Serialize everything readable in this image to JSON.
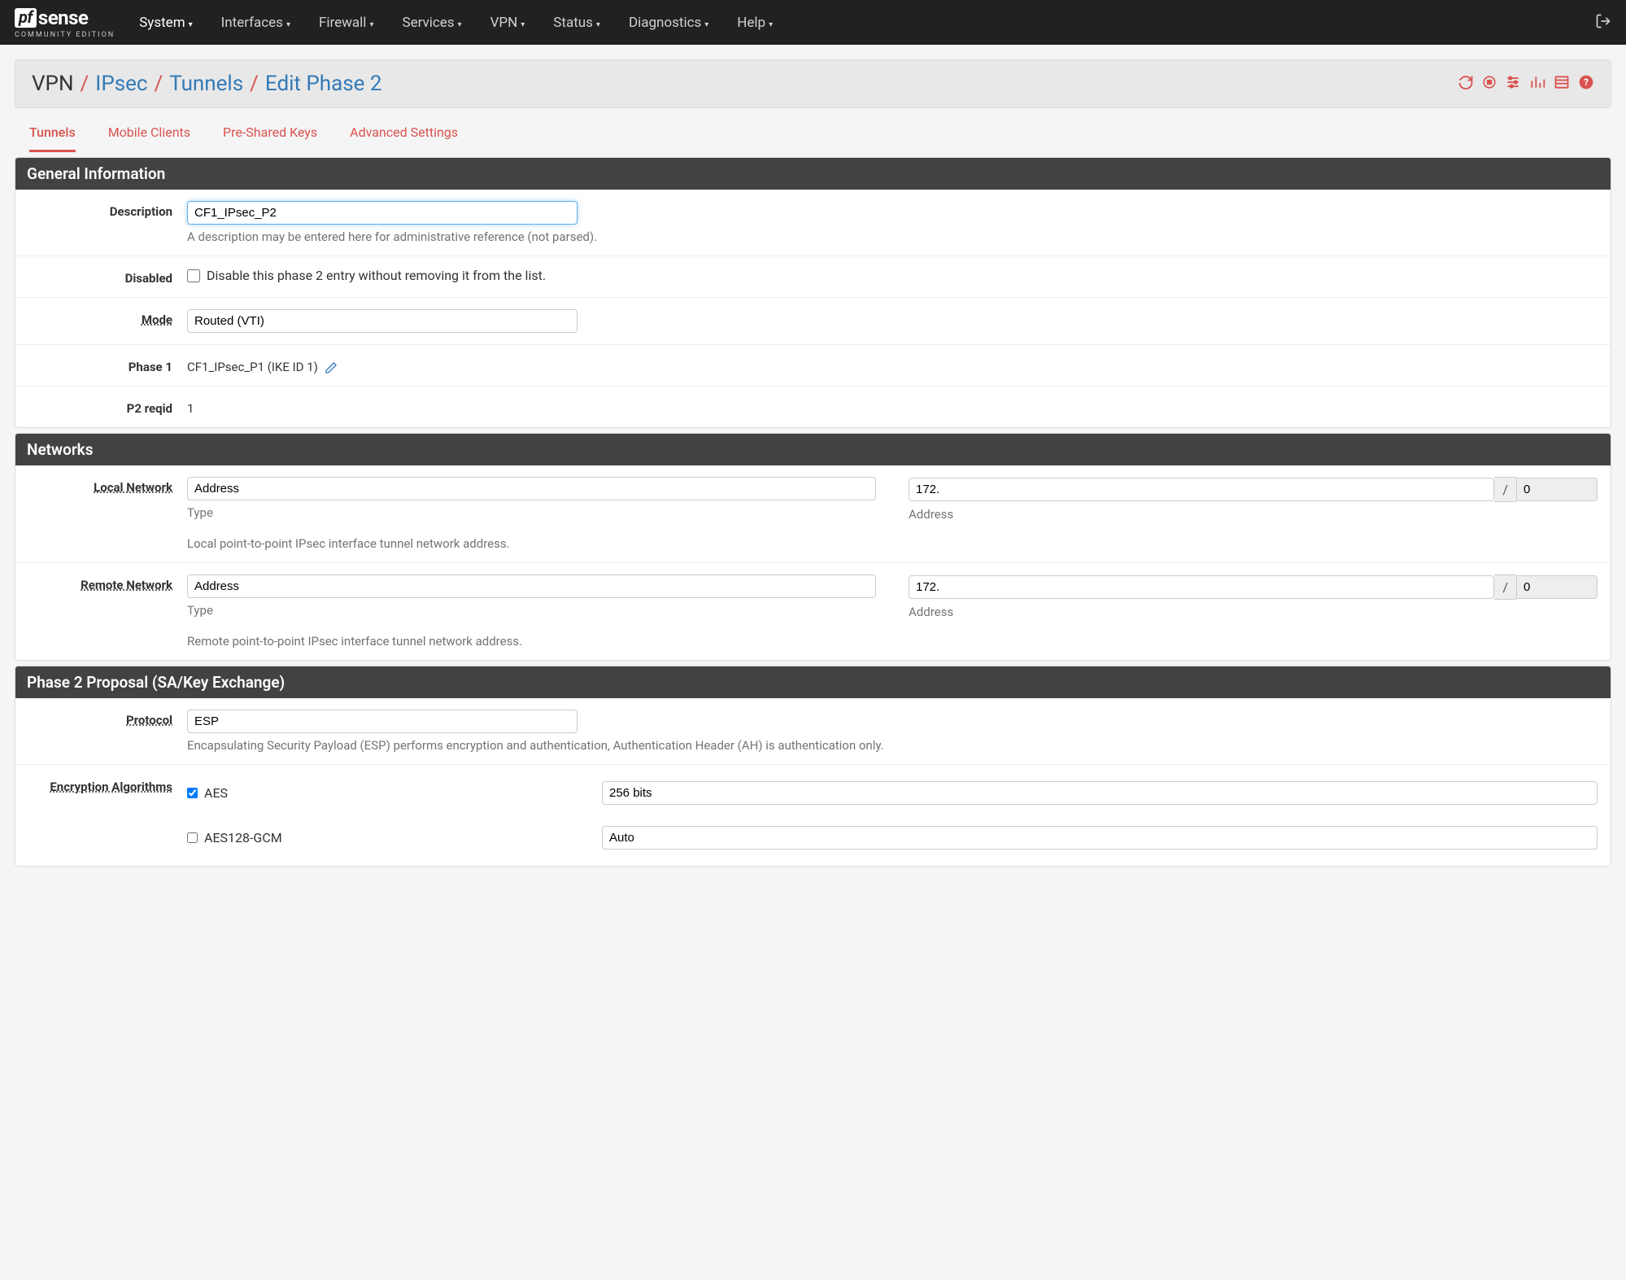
{
  "logo": {
    "pf": "pf",
    "sense": "sense",
    "sub": "COMMUNITY EDITION"
  },
  "nav": {
    "items": [
      "System",
      "Interfaces",
      "Firewall",
      "Services",
      "VPN",
      "Status",
      "Diagnostics",
      "Help"
    ],
    "active_index": 0,
    "logout_icon": "logout-icon"
  },
  "breadcrumb": {
    "root": "VPN",
    "parts": [
      "IPsec",
      "Tunnels",
      "Edit Phase 2"
    ]
  },
  "panel_icons": [
    "refresh-icon",
    "stop-target-icon",
    "sliders-icon",
    "chart-icon",
    "list-icon",
    "help-icon"
  ],
  "tabs": {
    "items": [
      "Tunnels",
      "Mobile Clients",
      "Pre-Shared Keys",
      "Advanced Settings"
    ],
    "active_index": 0
  },
  "sections": {
    "general": {
      "title": "General Information",
      "description": {
        "label": "Description",
        "value": "CF1_IPsec_P2",
        "help": "A description may be entered here for administrative reference (not parsed)."
      },
      "disabled": {
        "label": "Disabled",
        "checked": false,
        "text": "Disable this phase 2 entry without removing it from the list."
      },
      "mode": {
        "label": "Mode",
        "value": "Routed (VTI)"
      },
      "phase1": {
        "label": "Phase 1",
        "value": "CF1_IPsec_P1 (IKE ID 1)",
        "edit_icon": "pencil-icon"
      },
      "p2reqid": {
        "label": "P2 reqid",
        "value": "1"
      }
    },
    "networks": {
      "title": "Networks",
      "local": {
        "label": "Local Network",
        "type_value": "Address",
        "type_sub": "Type",
        "addr_value": "172.",
        "addr_sub": "Address",
        "cidr": "0",
        "help": "Local point-to-point IPsec interface tunnel network address."
      },
      "remote": {
        "label": "Remote Network",
        "type_value": "Address",
        "type_sub": "Type",
        "addr_value": "172.",
        "addr_sub": "Address",
        "cidr": "0",
        "help": "Remote point-to-point IPsec interface tunnel network address."
      }
    },
    "proposal": {
      "title": "Phase 2 Proposal (SA/Key Exchange)",
      "protocol": {
        "label": "Protocol",
        "value": "ESP",
        "help": "Encapsulating Security Payload (ESP) performs encryption and authentication, Authentication Header (AH) is authentication only."
      },
      "enc": {
        "label": "Encryption Algorithms",
        "rows": [
          {
            "name": "AES",
            "checked": true,
            "bits": "256 bits"
          },
          {
            "name": "AES128-GCM",
            "checked": false,
            "bits": "Auto"
          }
        ]
      }
    }
  }
}
